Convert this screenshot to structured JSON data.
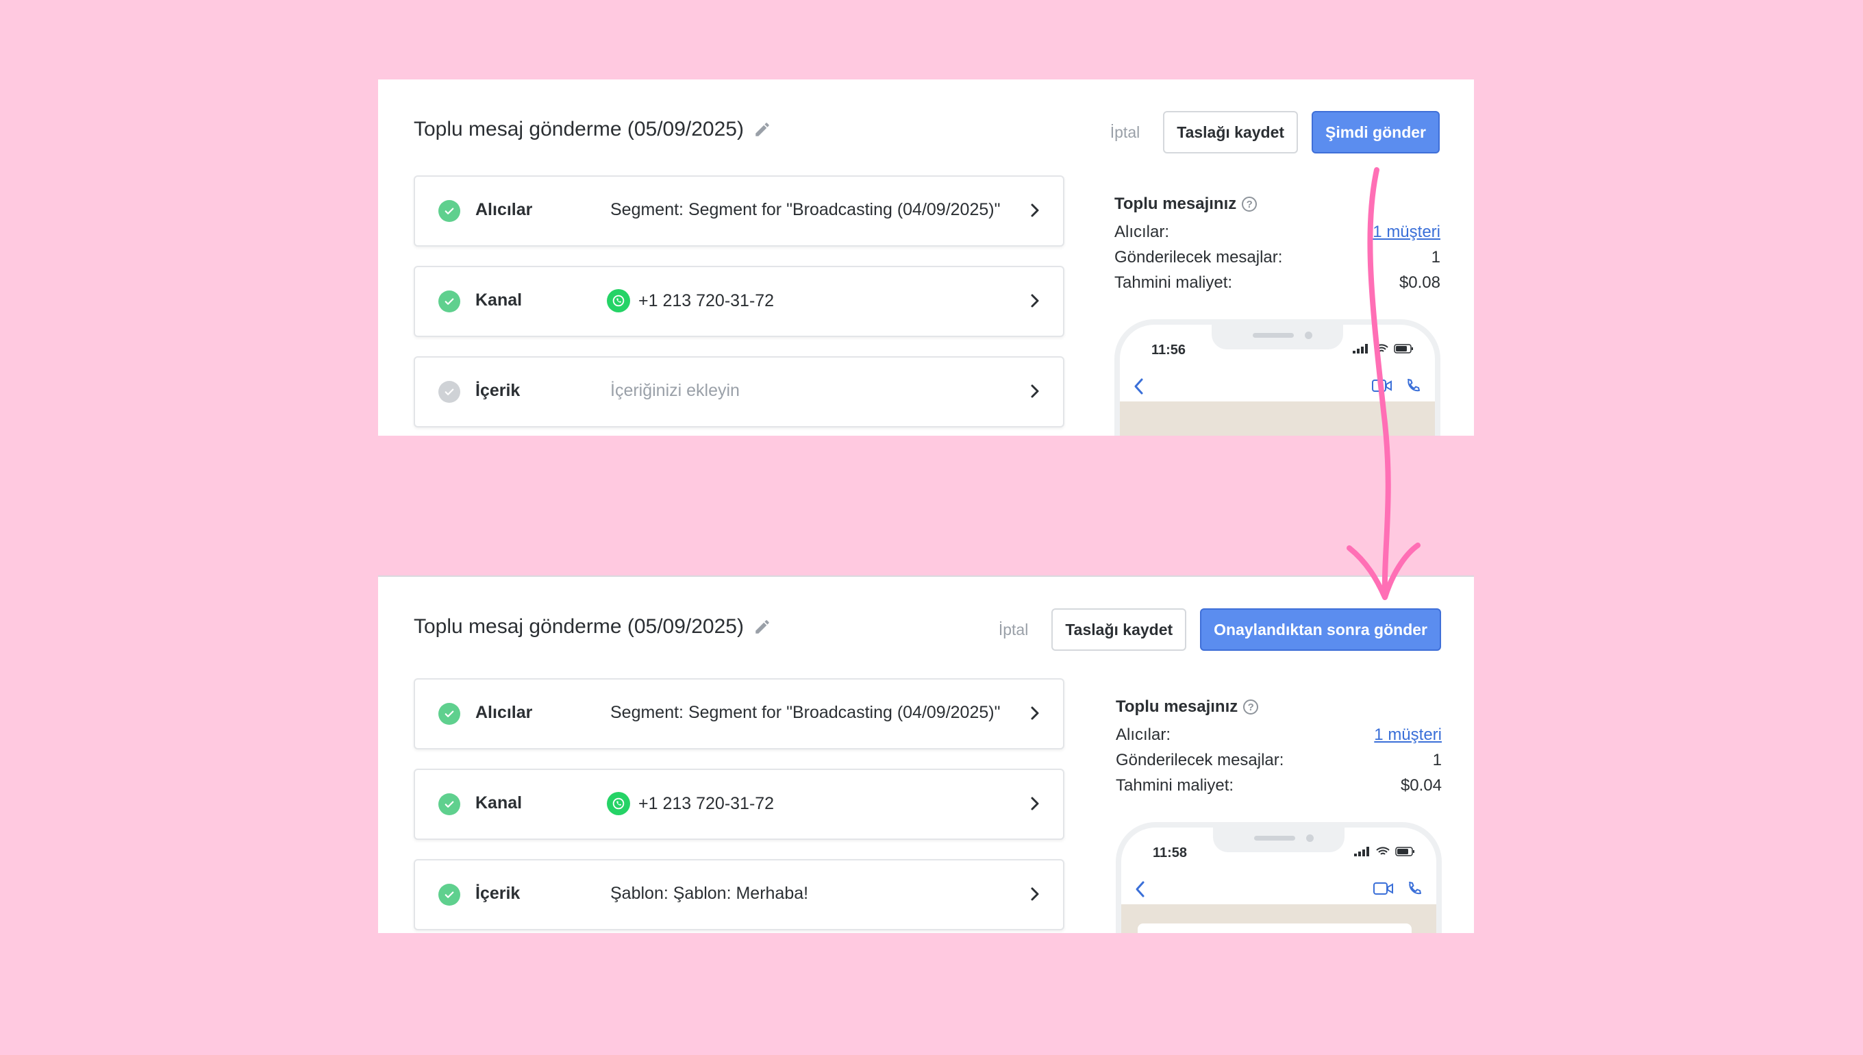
{
  "before": {
    "title": "Toplu mesaj gönderme (05/09/2025)",
    "actions": {
      "cancel": "İptal",
      "draft": "Taslağı kaydet",
      "send": "Şimdi gönder"
    },
    "steps": [
      {
        "label": "Alıcılar",
        "value": "Segment: Segment for \"Broadcasting (04/09/2025)\"",
        "status": "done"
      },
      {
        "label": "Kanal",
        "value": "+1 213 720-31-72",
        "status": "done",
        "icon": "whatsapp-icon"
      },
      {
        "label": "İçerik",
        "value": "İçeriğinizi ekleyin",
        "status": "todo"
      }
    ],
    "summary": {
      "title": "Toplu mesajınız",
      "recipients_label": "Alıcılar:",
      "recipients_value": "1 müşteri",
      "messages_label": "Gönderilecek mesajlar:",
      "messages_value": "1",
      "cost_label": "Tahmini maliyet:",
      "cost_value": "$0.08"
    },
    "phone_time": "11:56"
  },
  "after": {
    "title": "Toplu mesaj gönderme (05/09/2025)",
    "actions": {
      "cancel": "İptal",
      "draft": "Taslağı kaydet",
      "send": "Onaylandıktan sonra gönder"
    },
    "steps": [
      {
        "label": "Alıcılar",
        "value": "Segment: Segment for \"Broadcasting (04/09/2025)\"",
        "status": "done"
      },
      {
        "label": "Kanal",
        "value": "+1 213 720-31-72",
        "status": "done",
        "icon": "whatsapp-icon"
      },
      {
        "label": "İçerik",
        "value": "Şablon: Şablon: Merhaba!",
        "status": "done"
      }
    ],
    "summary": {
      "title": "Toplu mesajınız",
      "recipients_label": "Alıcılar:",
      "recipients_value": "1 müşteri",
      "messages_label": "Gönderilecek mesajlar:",
      "messages_value": "1",
      "cost_label": "Tahmini maliyet:",
      "cost_value": "$0.04"
    },
    "phone_time": "11:58"
  },
  "colors": {
    "background": "#ffc9e0",
    "primary_button": "#5b8def",
    "check_done": "#5fd08e",
    "check_todo": "#cfd2d6",
    "arrow": "#ff6fb5",
    "link": "#3a6fd8"
  }
}
